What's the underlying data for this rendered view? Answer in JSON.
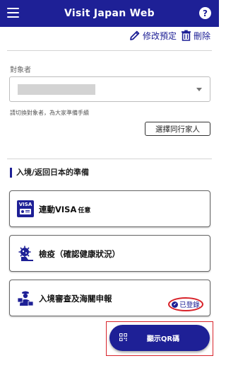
{
  "header": {
    "title": "Visit Japan Web",
    "help_label": "?"
  },
  "actions": {
    "edit_label": "修改預定",
    "delete_label": "刪除"
  },
  "target": {
    "label": "對象者",
    "selected_value": "",
    "hint": "請切換對象者，為大家準備手續",
    "companion_button": "選擇同行家人"
  },
  "section": {
    "title": "入境/返回日本的準備"
  },
  "cards": [
    {
      "label": "連動VISA",
      "tag": "任意",
      "icon": "visa-card-icon"
    },
    {
      "label": "檢疫（確認健康狀況）",
      "tag": "",
      "icon": "quarantine-virus-icon"
    },
    {
      "label": "入境審查及海關申報",
      "tag": "",
      "icon": "immigration-officer-icon"
    }
  ],
  "status": {
    "registered_label": "已登錄"
  },
  "qr_button": {
    "label": "顯示QR碼"
  },
  "colors": {
    "primary": "#1e2096",
    "highlight_red": "#d8232a"
  }
}
